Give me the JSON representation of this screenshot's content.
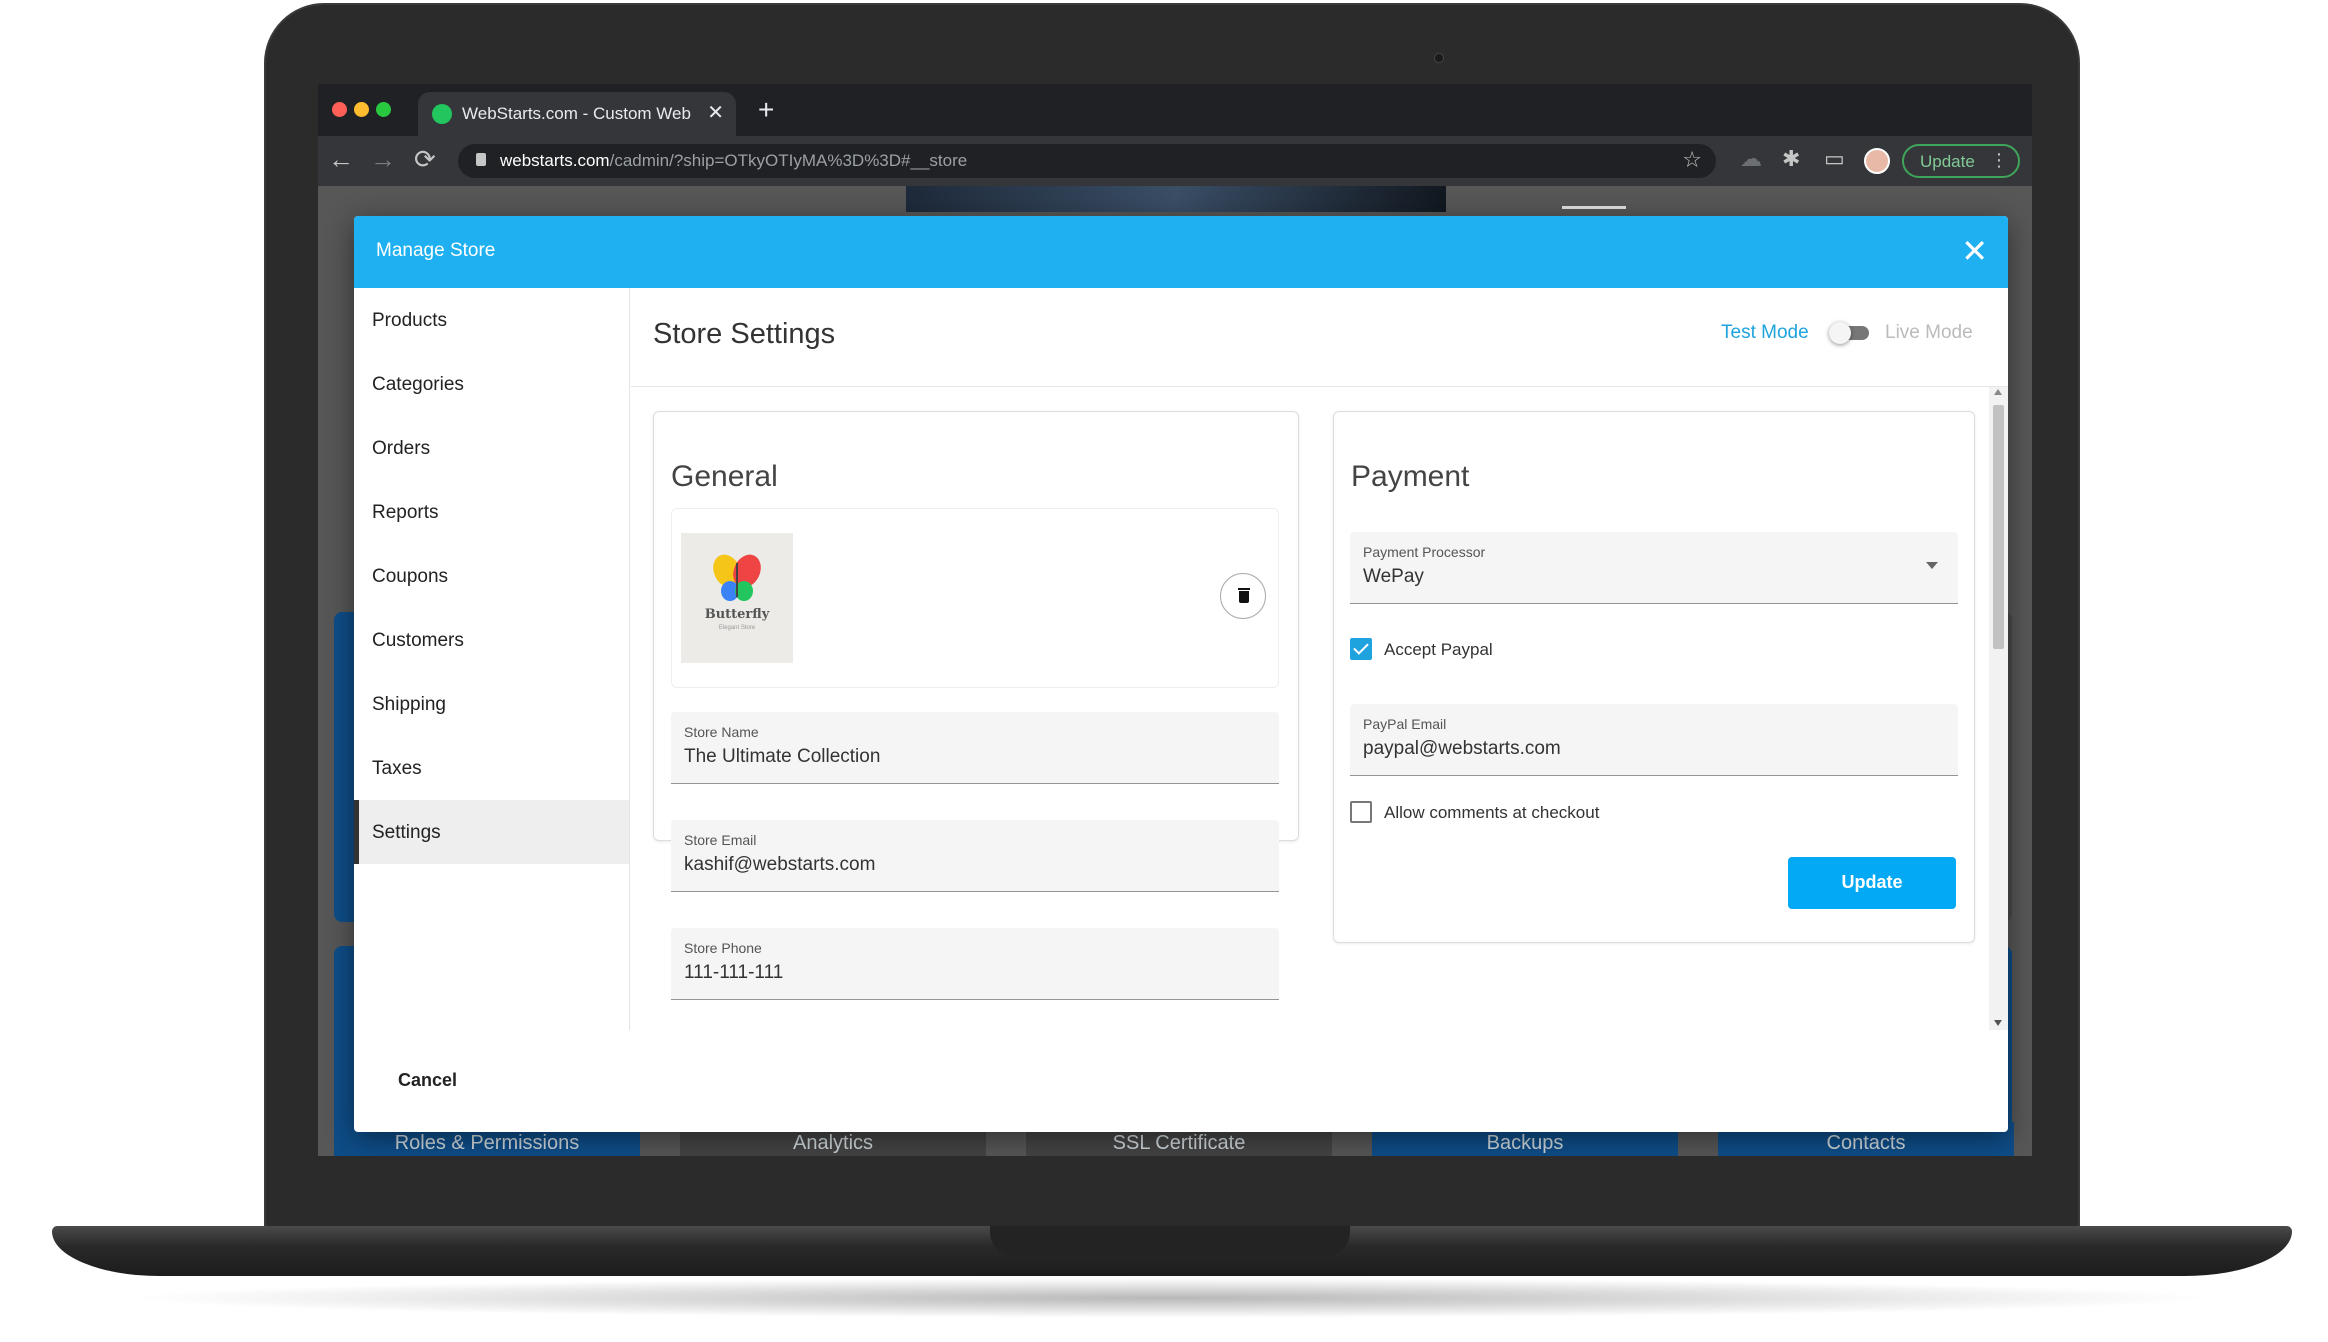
{
  "browser": {
    "tab_title": "WebStarts.com - Custom Web",
    "tab_close": "✕",
    "new_tab": "+",
    "url_domain": "webstarts.com",
    "url_path": "/cadmin/?ship=OTkyOTIyMA%3D%3D#__store",
    "update_label": "Update"
  },
  "background_tiles": [
    "Roles & Permissions",
    "Analytics",
    "SSL Certificate",
    "Backups",
    "Contacts"
  ],
  "modal": {
    "title": "Manage Store",
    "close": "✕"
  },
  "sidebar": {
    "items": [
      {
        "label": "Products"
      },
      {
        "label": "Categories"
      },
      {
        "label": "Orders"
      },
      {
        "label": "Reports"
      },
      {
        "label": "Coupons"
      },
      {
        "label": "Customers"
      },
      {
        "label": "Shipping"
      },
      {
        "label": "Taxes"
      },
      {
        "label": "Settings",
        "active": true
      }
    ]
  },
  "content": {
    "title": "Store Settings",
    "mode_test": "Test Mode",
    "mode_live": "Live Mode",
    "mode_is_live": false
  },
  "general": {
    "title": "General",
    "logo": {
      "name": "Butterfly",
      "tagline": "Elegant Store"
    },
    "store_name": {
      "label": "Store Name",
      "value": "The Ultimate Collection"
    },
    "store_email": {
      "label": "Store Email",
      "value": "kashif@webstarts.com"
    },
    "store_phone": {
      "label": "Store Phone",
      "value": "111-111-111"
    }
  },
  "payment": {
    "title": "Payment",
    "processor": {
      "label": "Payment Processor",
      "value": "WePay"
    },
    "accept_paypal": {
      "label": "Accept Paypal",
      "checked": true
    },
    "paypal_email": {
      "label": "PayPal Email",
      "value": "paypal@webstarts.com"
    },
    "allow_comments": {
      "label": "Allow comments at checkout",
      "checked": false
    },
    "update_label": "Update"
  },
  "footer": {
    "cancel_label": "Cancel"
  },
  "colors": {
    "header": "#1fb0f2",
    "accent": "#03a9f4",
    "link": "#1fa3df"
  }
}
